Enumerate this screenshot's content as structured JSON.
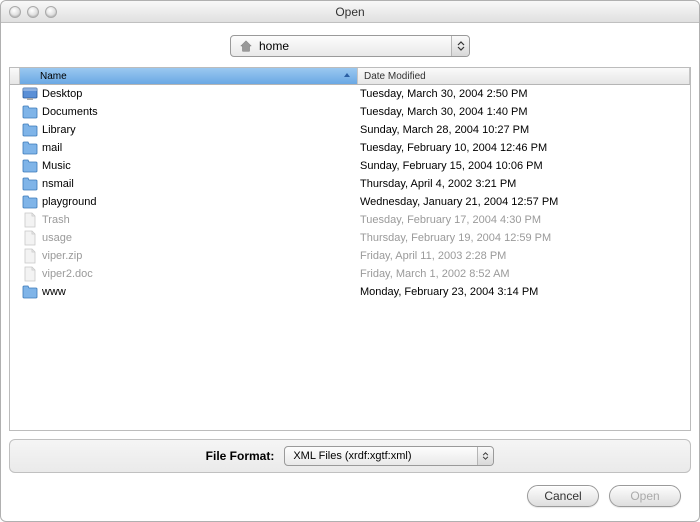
{
  "window": {
    "title": "Open"
  },
  "location": {
    "label": "home"
  },
  "columns": {
    "name": "Name",
    "date": "Date Modified"
  },
  "files": [
    {
      "name": "Desktop",
      "date": "Tuesday, March 30, 2004 2:50 PM",
      "icon": "desktop",
      "enabled": true
    },
    {
      "name": "Documents",
      "date": "Tuesday, March 30, 2004 1:40 PM",
      "icon": "folder",
      "enabled": true
    },
    {
      "name": "Library",
      "date": "Sunday, March 28, 2004 10:27 PM",
      "icon": "folder",
      "enabled": true
    },
    {
      "name": "mail",
      "date": "Tuesday, February 10, 2004 12:46 PM",
      "icon": "folder",
      "enabled": true
    },
    {
      "name": "Music",
      "date": "Sunday, February 15, 2004 10:06 PM",
      "icon": "folder",
      "enabled": true
    },
    {
      "name": "nsmail",
      "date": "Thursday, April 4, 2002 3:21 PM",
      "icon": "folder",
      "enabled": true
    },
    {
      "name": "playground",
      "date": "Wednesday, January 21, 2004 12:57 PM",
      "icon": "folder",
      "enabled": true
    },
    {
      "name": "Trash",
      "date": "Tuesday, February 17, 2004 4:30 PM",
      "icon": "file",
      "enabled": false
    },
    {
      "name": "usage",
      "date": "Thursday, February 19, 2004 12:59 PM",
      "icon": "file",
      "enabled": false
    },
    {
      "name": "viper.zip",
      "date": "Friday, April 11, 2003 2:28 PM",
      "icon": "file",
      "enabled": false
    },
    {
      "name": "viper2.doc",
      "date": "Friday, March 1, 2002 8:52 AM",
      "icon": "file",
      "enabled": false
    },
    {
      "name": "www",
      "date": "Monday, February 23, 2004 3:14 PM",
      "icon": "folder",
      "enabled": true
    }
  ],
  "format": {
    "label": "File Format:",
    "value": "XML Files (xrdf:xgtf:xml)"
  },
  "buttons": {
    "cancel": "Cancel",
    "open": "Open"
  }
}
